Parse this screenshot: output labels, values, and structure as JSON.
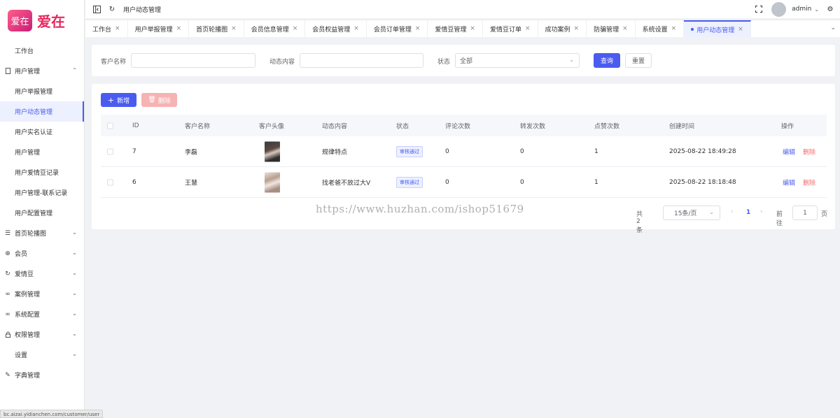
{
  "app": {
    "logo_mark": "爱在",
    "logo_text": "爱在"
  },
  "sidebar": {
    "items": [
      {
        "label": "工作台"
      },
      {
        "label": "用户管理",
        "icon": "doc-icon",
        "expanded": true,
        "children": [
          "用户举报管理",
          "用户动态管理",
          "用户实名认证",
          "用户管理",
          "用户爱情豆记录",
          "用户管理-联系记录",
          "用户配置管理"
        ],
        "active_child": "用户动态管理"
      },
      {
        "label": "首页轮播图",
        "icon": "list-icon"
      },
      {
        "label": "会员",
        "icon": "globe-icon"
      },
      {
        "label": "爱情豆",
        "icon": "refresh-icon"
      },
      {
        "label": "案例管理",
        "icon": "link-icon"
      },
      {
        "label": "系统配置",
        "icon": "link-icon"
      },
      {
        "label": "权限管理",
        "icon": "lock-icon"
      },
      {
        "label": "设置"
      },
      {
        "label": "字典管理",
        "icon": "pen-icon"
      }
    ]
  },
  "status_bar_url": "bc.aizai.yidianchen.com/customer/user",
  "header": {
    "breadcrumb": "用户动态管理",
    "username": "admin"
  },
  "tabs": [
    {
      "label": "工作台"
    },
    {
      "label": "用户举报管理"
    },
    {
      "label": "首页轮播图"
    },
    {
      "label": "会员信息管理"
    },
    {
      "label": "会员权益管理"
    },
    {
      "label": "会员订单管理"
    },
    {
      "label": "爱情豆管理"
    },
    {
      "label": "爱情豆订单"
    },
    {
      "label": "成功案例"
    },
    {
      "label": "防骗管理"
    },
    {
      "label": "系统设置"
    },
    {
      "label": "用户动态管理",
      "active": true
    }
  ],
  "search": {
    "customer_label": "客户名称",
    "customer_value": "",
    "content_label": "动态内容",
    "content_value": "",
    "status_label": "状态",
    "status_value": "全部",
    "query_label": "查询",
    "reset_label": "重置"
  },
  "actions": {
    "add_label": "新增",
    "delete_label": "删除"
  },
  "table": {
    "columns": [
      "ID",
      "客户名称",
      "客户头像",
      "动态内容",
      "状态",
      "评论次数",
      "转发次数",
      "点赞次数",
      "创建时间",
      "操作"
    ],
    "rows": [
      {
        "id": "7",
        "name": "李磊",
        "content": "规律特点",
        "status": "审核通过",
        "comments": "0",
        "shares": "0",
        "likes": "1",
        "created": "2025-08-22 18:49:28",
        "edit": "编辑",
        "delete": "删除"
      },
      {
        "id": "6",
        "name": "王慧",
        "content": "找老爸不放过大V",
        "status": "审核通过",
        "comments": "0",
        "shares": "0",
        "likes": "1",
        "created": "2025-08-22 18:18:48",
        "edit": "编辑",
        "delete": "删除"
      }
    ]
  },
  "pagination": {
    "total": "共 2 条",
    "page_size": "15条/页",
    "current": "1",
    "goto_label": "前往",
    "goto_value": "1",
    "page_suffix": "页"
  },
  "watermark": "https://www.huzhan.com/ishop51679",
  "colors": {
    "primary": "#4a5cf0",
    "danger": "#f56c6c",
    "brand": "#e8285f"
  }
}
